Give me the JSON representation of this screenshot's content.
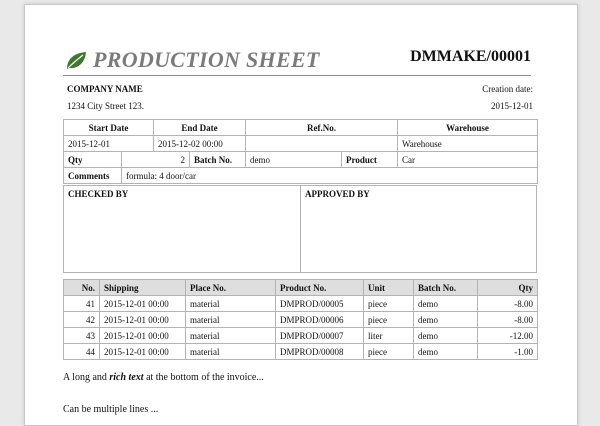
{
  "header": {
    "title": "PRODUCTION SHEET",
    "doc_number": "DMMAKE/00001"
  },
  "company": {
    "name": "COMPANY NAME",
    "address": "1234 City Street 123.",
    "creation_label": "Creation date:",
    "creation_date": "2015-12-01"
  },
  "info": {
    "start_date_label": "Start Date",
    "end_date_label": "End Date",
    "ref_no_label": "Ref.No.",
    "warehouse_label": "Warehouse",
    "start_date": "2015-12-01",
    "end_date": "2015-12-02 00:00",
    "ref_no": "",
    "warehouse": "Warehouse",
    "qty_label": "Qty",
    "qty": "2",
    "batch_label": "Batch No.",
    "batch": "demo",
    "product_label": "Product",
    "product": "Car",
    "comments_label": "Comments",
    "comments": "formula: 4 door/car"
  },
  "signatures": {
    "checked_by": "CHECKED BY",
    "approved_by": "APPROVED BY"
  },
  "lines": {
    "headers": [
      "No.",
      "Shipping",
      "Place No.",
      "Product No.",
      "Unit",
      "Batch No.",
      "Qty"
    ],
    "rows": [
      [
        "41",
        "2015-12-01 00:00",
        "material",
        "DMPROD/00005",
        "piece",
        "demo",
        "-8.00"
      ],
      [
        "42",
        "2015-12-01 00:00",
        "material",
        "DMPROD/00006",
        "piece",
        "demo",
        "-8.00"
      ],
      [
        "43",
        "2015-12-01 00:00",
        "material",
        "DMPROD/00007",
        "liter",
        "demo",
        "-12.00"
      ],
      [
        "44",
        "2015-12-01 00:00",
        "material",
        "DMPROD/00008",
        "piece",
        "demo",
        "-1.00"
      ]
    ]
  },
  "footer": {
    "text_before": "A long and ",
    "rich": "rich text",
    "text_after": " at the bottom of the invoice...",
    "line2": "Can be multiple lines ..."
  },
  "icons": {
    "logo": "leaf-icon"
  },
  "colors": {
    "title": "#7b7b7b",
    "leaf": "#3d7a2c",
    "header_bg": "#dedede"
  }
}
